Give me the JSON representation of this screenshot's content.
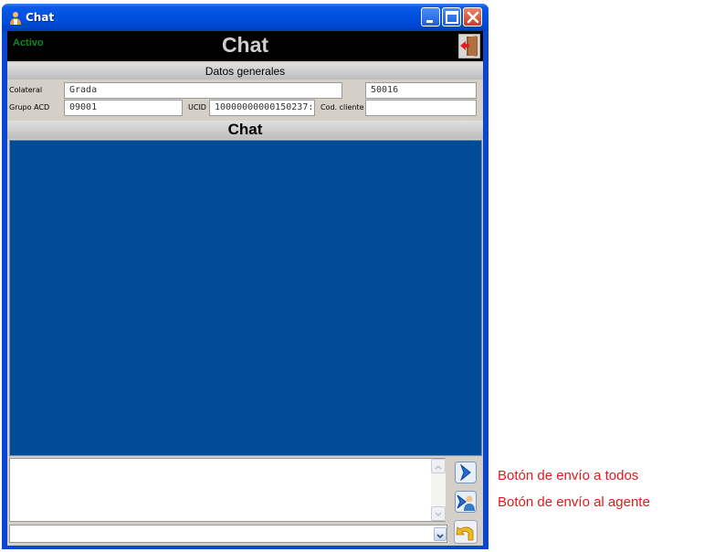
{
  "window": {
    "title": "Chat"
  },
  "header": {
    "status": "Activo",
    "title": "Chat"
  },
  "general": {
    "section_title": "Datos generales",
    "collateral_label": "Colateral",
    "collateral_value": "Grada",
    "collateral_code": "50016",
    "acd_label": "Grupo ACD",
    "acd_value": "09001",
    "ucid_label": "UCID",
    "ucid_value": "10000000000150237:",
    "client_label": "Cod. cliente",
    "client_value": ""
  },
  "chat": {
    "section_title": "Chat"
  },
  "callouts": {
    "send_all": "Botón de envío a todos",
    "send_agent": "Botón de envío al agente"
  },
  "colors": {
    "chat_bg": "#004c98",
    "callout": "#e01b1b",
    "status": "#0c8a20",
    "titlebar": "#0050e0"
  }
}
